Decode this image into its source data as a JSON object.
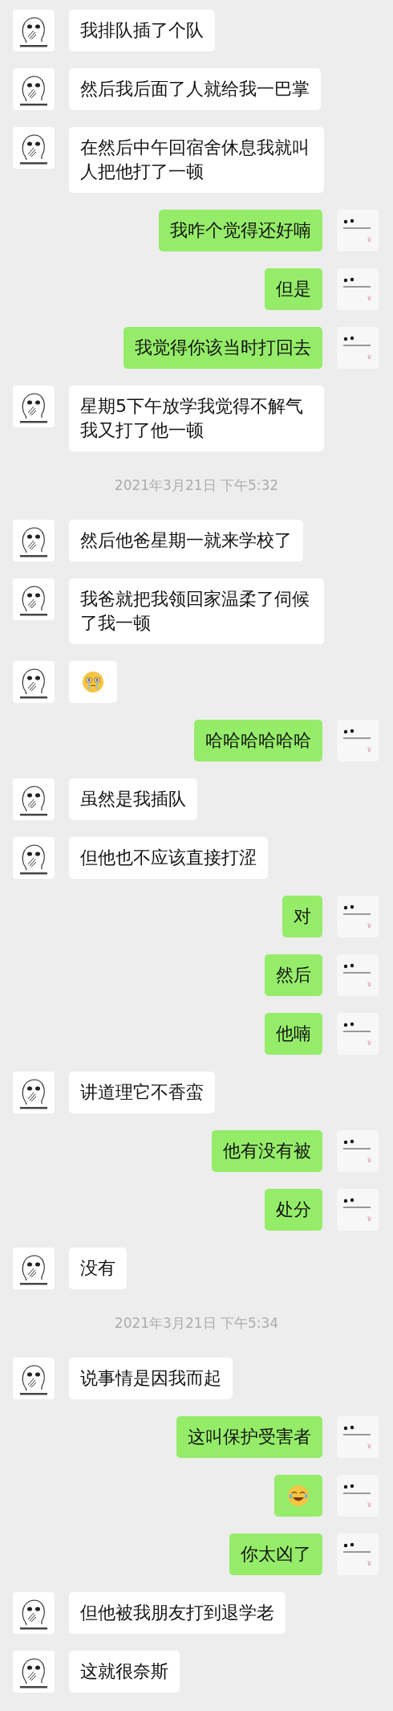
{
  "messages": [
    {
      "kind": "text",
      "outgoing": false,
      "text": "我排队插了个队"
    },
    {
      "kind": "text",
      "outgoing": false,
      "text": "然后我后面了人就给我一巴掌"
    },
    {
      "kind": "text",
      "outgoing": false,
      "text": "在然后中午回宿舍休息我就叫人把他打了一顿"
    },
    {
      "kind": "text",
      "outgoing": true,
      "text": "我咋个觉得还好喃"
    },
    {
      "kind": "text",
      "outgoing": true,
      "text": "但是"
    },
    {
      "kind": "text",
      "outgoing": true,
      "text": "我觉得你该当时打回去"
    },
    {
      "kind": "text",
      "outgoing": false,
      "text": "星期5下午放学我觉得不解气我又打了他一顿"
    },
    {
      "kind": "time",
      "text": "2021年3月21日 下午5:32"
    },
    {
      "kind": "text",
      "outgoing": false,
      "text": "然后他爸星期一就来学校了"
    },
    {
      "kind": "text",
      "outgoing": false,
      "text": "我爸就把我领回家温柔了伺候了我一顿"
    },
    {
      "kind": "crying",
      "outgoing": false
    },
    {
      "kind": "text",
      "outgoing": true,
      "text": "哈哈哈哈哈哈"
    },
    {
      "kind": "text",
      "outgoing": false,
      "text": "虽然是我插队"
    },
    {
      "kind": "text",
      "outgoing": false,
      "text": "但他也不应该直接打涩"
    },
    {
      "kind": "text",
      "outgoing": true,
      "text": "对"
    },
    {
      "kind": "text",
      "outgoing": true,
      "text": "然后"
    },
    {
      "kind": "text",
      "outgoing": true,
      "text": "他喃"
    },
    {
      "kind": "text",
      "outgoing": false,
      "text": "讲道理它不香蛮"
    },
    {
      "kind": "text",
      "outgoing": true,
      "text": "他有没有被"
    },
    {
      "kind": "text",
      "outgoing": true,
      "text": "处分"
    },
    {
      "kind": "text",
      "outgoing": false,
      "text": "没有"
    },
    {
      "kind": "time",
      "text": "2021年3月21日 下午5:34"
    },
    {
      "kind": "text",
      "outgoing": false,
      "text": "说事情是因我而起"
    },
    {
      "kind": "text",
      "outgoing": true,
      "text": "这叫保护受害者"
    },
    {
      "kind": "laughing",
      "outgoing": true
    },
    {
      "kind": "text",
      "outgoing": true,
      "text": "你太凶了"
    },
    {
      "kind": "text",
      "outgoing": false,
      "text": "但他被我朋友打到退学老"
    },
    {
      "kind": "text",
      "outgoing": false,
      "text": "这就很奈斯"
    }
  ]
}
